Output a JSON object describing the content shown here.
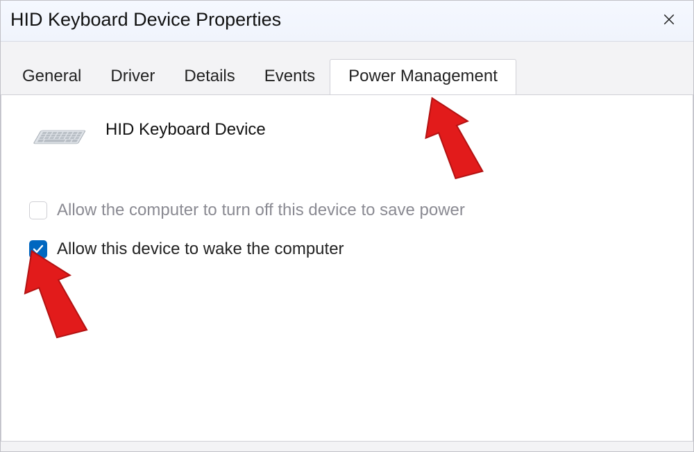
{
  "window": {
    "title": "HID Keyboard Device Properties"
  },
  "tabs": {
    "general": "General",
    "driver": "Driver",
    "details": "Details",
    "events": "Events",
    "power_management": "Power Management"
  },
  "device": {
    "name": "HID Keyboard Device",
    "icon": "keyboard-icon"
  },
  "options": {
    "turn_off_label": "Allow the computer to turn off this device to save power",
    "turn_off_checked": false,
    "turn_off_enabled": false,
    "wake_label": "Allow this device to wake the computer",
    "wake_checked": true,
    "wake_enabled": true
  }
}
